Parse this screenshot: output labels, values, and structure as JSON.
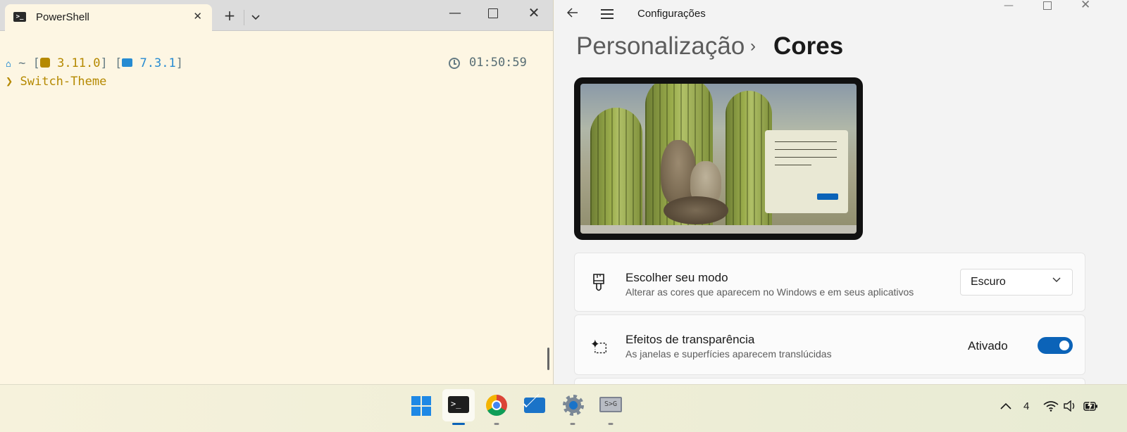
{
  "terminal": {
    "tab_title": "PowerShell",
    "tab_close": "✕",
    "new_tab": "+",
    "dropdown": "⌄",
    "prompt": {
      "home_glyph": "⌂",
      "tilde": "~",
      "python_version": "3.11.0",
      "pwsh_version": "7.3.1",
      "time": "01:50:59",
      "prompt_char": "❯",
      "command": "Switch-Theme"
    }
  },
  "settings": {
    "window_title": "Configurações",
    "breadcrumb": {
      "parent": "Personalização",
      "separator": "›",
      "current": "Cores"
    },
    "mode_card": {
      "title": "Escolher seu modo",
      "description": "Alterar as cores que aparecem no Windows e em seus aplicativos",
      "selected": "Escuro"
    },
    "transparency_card": {
      "title": "Efeitos de transparência",
      "description": "As janelas e superfícies aparecem translúcidas",
      "state_label": "Ativado",
      "enabled": true
    },
    "accent_color": "#0b63b8"
  },
  "taskbar": {
    "apps": [
      {
        "name": "start",
        "icon": "windows-logo-icon"
      },
      {
        "name": "terminal",
        "icon": "terminal-icon",
        "active": true
      },
      {
        "name": "chrome",
        "icon": "chrome-icon"
      },
      {
        "name": "mail",
        "icon": "mail-icon"
      },
      {
        "name": "settings",
        "icon": "settings-gear-icon"
      },
      {
        "name": "snipping",
        "icon": "snipping-tool-icon",
        "label": "S>G"
      }
    ],
    "tray": {
      "chevron": "︿",
      "count": "4",
      "volume_glyph": "🔊"
    }
  }
}
